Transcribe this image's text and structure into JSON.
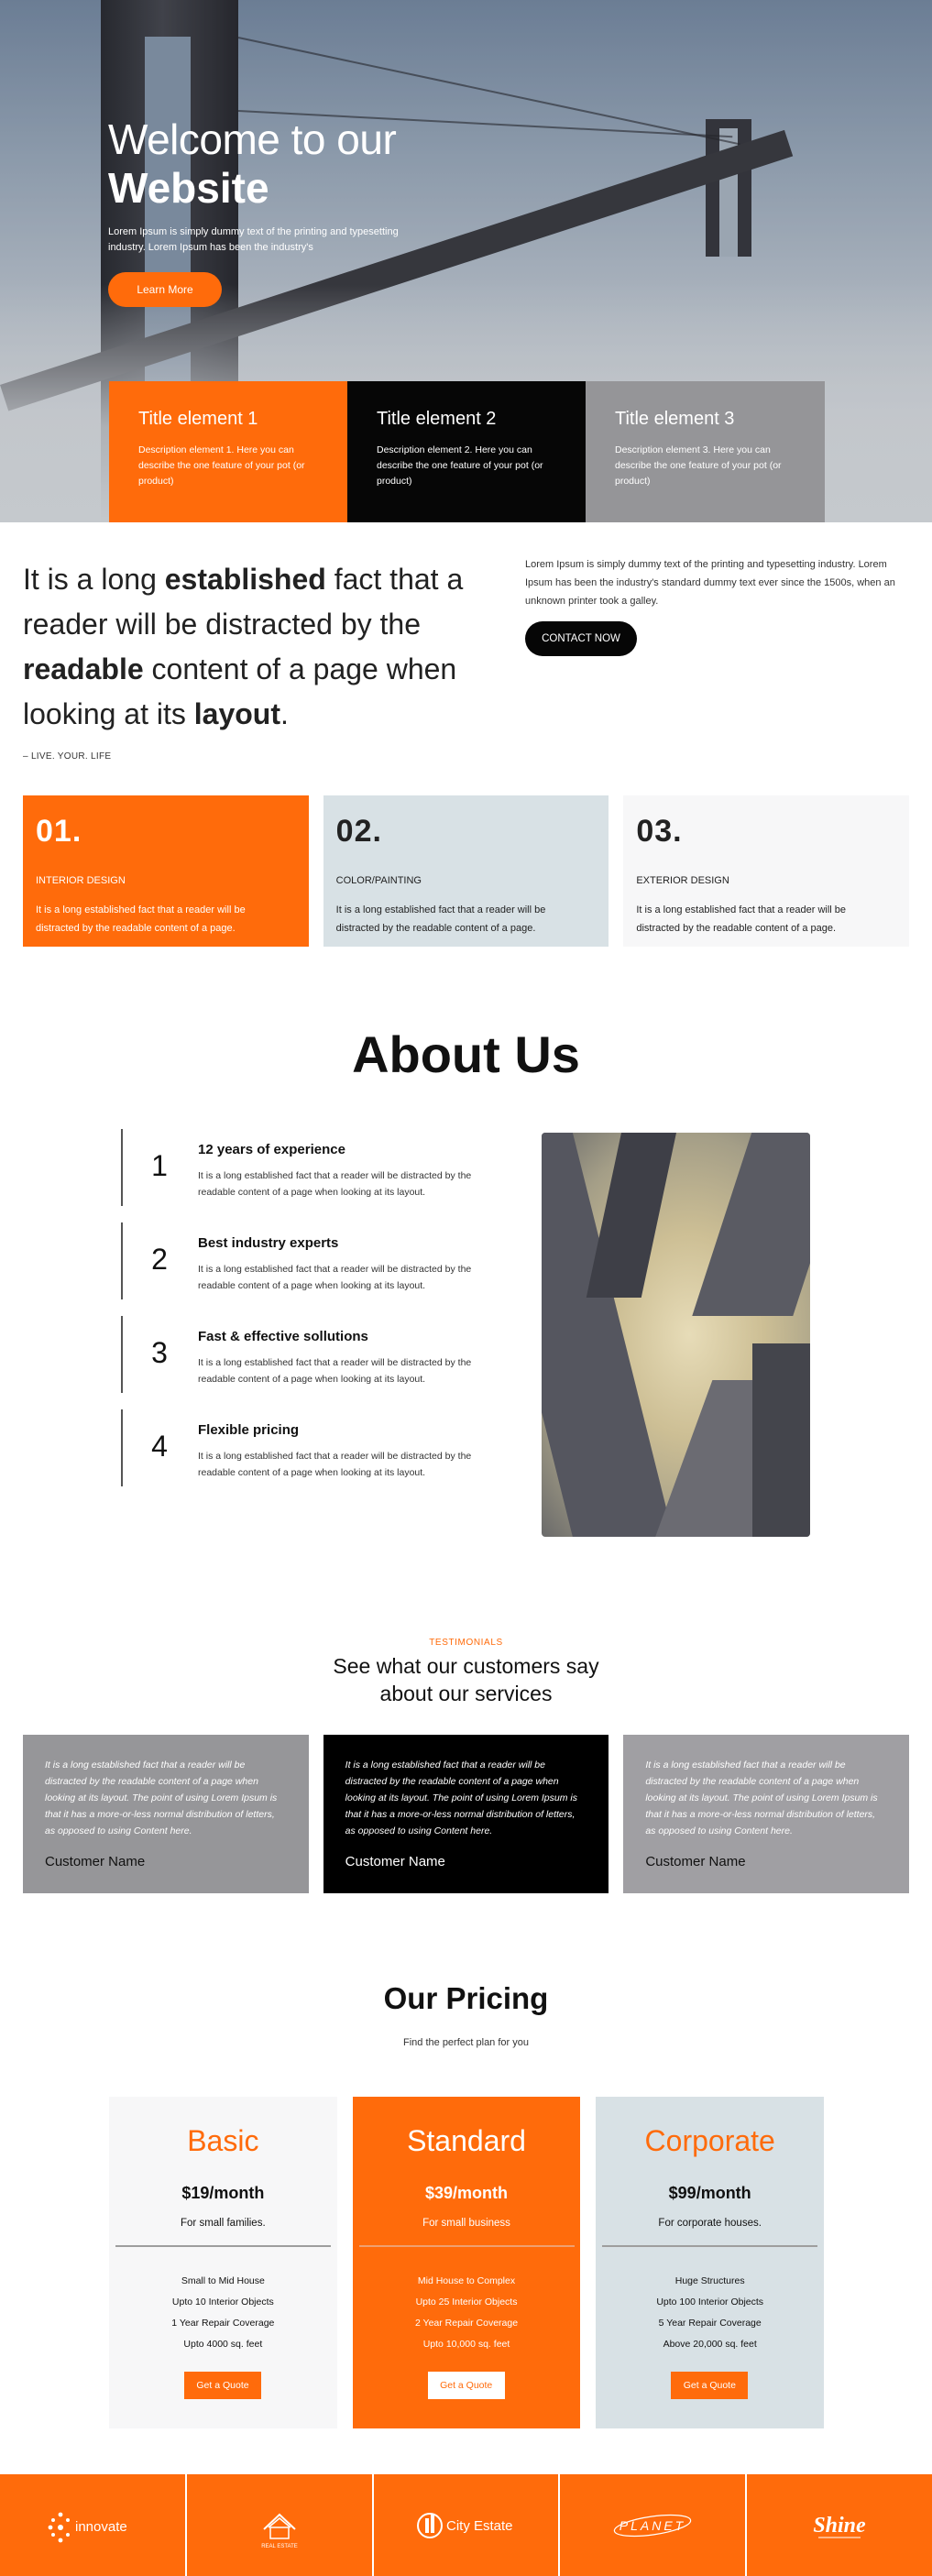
{
  "hero": {
    "title_line1": "Welcome to our",
    "title_line2": "Website",
    "text": "Lorem Ipsum is simply dummy text of the printing and typesetting industry. Lorem Ipsum has been the industry's",
    "button_label": "Learn More"
  },
  "features": [
    {
      "title": "Title element 1",
      "description": "Description element 1. Here you can describe the one feature of your pot (or product)"
    },
    {
      "title": "Title element 2",
      "description": "Description element 2. Here you can describe the one feature of your pot (or product)"
    },
    {
      "title": "Title element 3",
      "description": "Description element 3. Here you can describe the one feature of your pot (or product)"
    }
  ],
  "intro": {
    "quote": {
      "p1": "It is a long ",
      "b1": "established",
      "p2": " fact that a reader will be distracted by the ",
      "b2": "readable",
      "p3": " content of a page when looking at its ",
      "b3": "layout",
      "p4": "."
    },
    "tagline": "– LIVE. YOUR. LIFE",
    "paragraph": "Lorem Ipsum is simply dummy text of the printing and typesetting industry. Lorem Ipsum has been the industry's standard dummy text ever since the 1500s, when an unknown printer took a galley.",
    "button_label": "CONTACT NOW"
  },
  "services": [
    {
      "number": "01.",
      "label": "INTERIOR DESIGN",
      "text": "It is a long established fact that a reader will be distracted by the readable content of a page."
    },
    {
      "number": "02.",
      "label": "COLOR/PAINTING",
      "text": "It is a long established fact that a reader will be distracted by the readable content of a page."
    },
    {
      "number": "03.",
      "label": "EXTERIOR DESIGN",
      "text": "It is a long established fact that a reader will be distracted by the readable content of a page."
    }
  ],
  "about": {
    "title": "About Us",
    "items": [
      {
        "number": "1",
        "heading": "12 years of experience",
        "text": "It is a long established fact that a reader will be distracted by the readable content of a page when looking at its layout."
      },
      {
        "number": "2",
        "heading": "Best industry experts",
        "text": "It is a long established fact that a reader will be distracted by the readable content of a page when looking at its layout."
      },
      {
        "number": "3",
        "heading": "Fast & effective sollutions",
        "text": "It is a long established fact that a reader will be distracted by the readable content of a page when looking at its layout."
      },
      {
        "number": "4",
        "heading": "Flexible pricing",
        "text": "It is a long established fact that a reader will be distracted by the readable content of a page when looking at its layout."
      }
    ]
  },
  "testimonials": {
    "kicker": "TESTIMONIALS",
    "title_line1": "See what our customers say",
    "title_line2": "about our services",
    "items": [
      {
        "quote": "It is a long established fact that a reader will be distracted by the readable content of a page when looking at its layout. The point of using Lorem Ipsum is that it has a more-or-less normal distribution of letters, as opposed to using Content here.",
        "name": "Customer Name"
      },
      {
        "quote": "It is a long established fact that a reader will be distracted by the readable content of a page when looking at its layout. The point of using Lorem Ipsum is that it has a more-or-less normal distribution of letters, as opposed to using Content here.",
        "name": "Customer Name"
      },
      {
        "quote": "It is a long established fact that a reader will be distracted by the readable content of a page when looking at its layout. The point of using Lorem Ipsum is that it has a more-or-less normal distribution of letters, as opposed to using Content here.",
        "name": "Customer Name"
      }
    ]
  },
  "pricing": {
    "title": "Our Pricing",
    "subtitle": "Find the perfect plan for you",
    "plans": [
      {
        "name": "Basic",
        "price": "$19/month",
        "desc": "For small families.",
        "features": [
          "Small to Mid House",
          "Upto 10 Interior Objects",
          "1 Year Repair Coverage",
          "Upto 4000 sq. feet"
        ],
        "button": "Get a Quote"
      },
      {
        "name": "Standard",
        "price": "$39/month",
        "desc": "For small business",
        "features": [
          "Mid House to Complex",
          "Upto 25 Interior Objects",
          "2 Year Repair Coverage",
          "Upto 10,000 sq. feet"
        ],
        "button": "Get a Quote"
      },
      {
        "name": "Corporate",
        "price": "$99/month",
        "desc": "For corporate houses.",
        "features": [
          "Huge Structures",
          "Upto 100 Interior Objects",
          "5 Year Repair Coverage",
          "Above 20,000 sq. feet"
        ],
        "button": "Get a Quote"
      }
    ]
  },
  "logos": {
    "innovate": "innovate",
    "real_estate": "REAL ESTATE",
    "city_estate": "City Estate",
    "planet": "PLANET",
    "shine": "Shine"
  },
  "colors": {
    "accent": "#ff6b0b",
    "dark": "#060606",
    "gray": "#959598",
    "light_blue": "#d8e1e5",
    "light_gray": "#f7f7f8"
  }
}
